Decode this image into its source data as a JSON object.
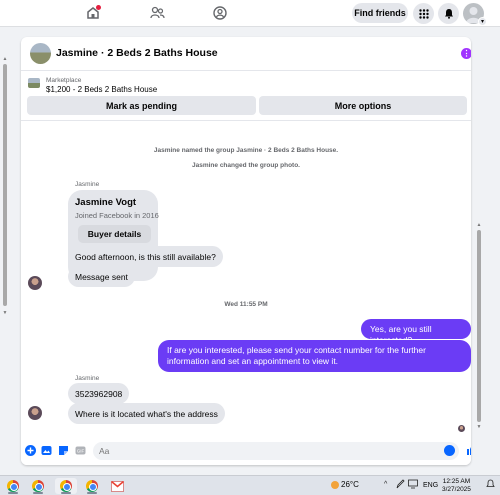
{
  "nav": {
    "find_friends": "Find friends"
  },
  "chat": {
    "title": "Jasmine · 2 Beds 2 Baths House",
    "marketplace_label": "Marketplace",
    "listing": "$1,200 - 2 Beds 2 Baths House",
    "mark_pending": "Mark as pending",
    "more_options": "More options",
    "system_messages": [
      "Jasmine named the group Jasmine · 2 Beds 2 Baths House.",
      "Jasmine changed the group photo."
    ],
    "sender_name": "Jasmine",
    "profile_card": {
      "name": "Jasmine Vogt",
      "joined": "Joined Facebook in 2016",
      "button": "Buyer details"
    },
    "messages_in_1": [
      "Good afternoon, is this still available?",
      "Message sent"
    ],
    "timestamp": "Wed 11:55 PM",
    "messages_out": [
      "Yes, are you still interested?",
      "If are you interested, please send your contact number  for the further information and set an appointment to view it."
    ],
    "sender_name_2": "Jasmine",
    "messages_in_2": [
      "3523962908",
      "Where is it located what's the address"
    ],
    "composer_placeholder": "Aa"
  },
  "colors": {
    "accent_purple": "#6b3cf5",
    "fb_blue": "#0866ff",
    "bubble_grey": "#e4e6eb"
  },
  "taskbar": {
    "weather": "26°C",
    "lang": "ENG",
    "time": "12:25 AM",
    "date": "3/27/2025"
  }
}
